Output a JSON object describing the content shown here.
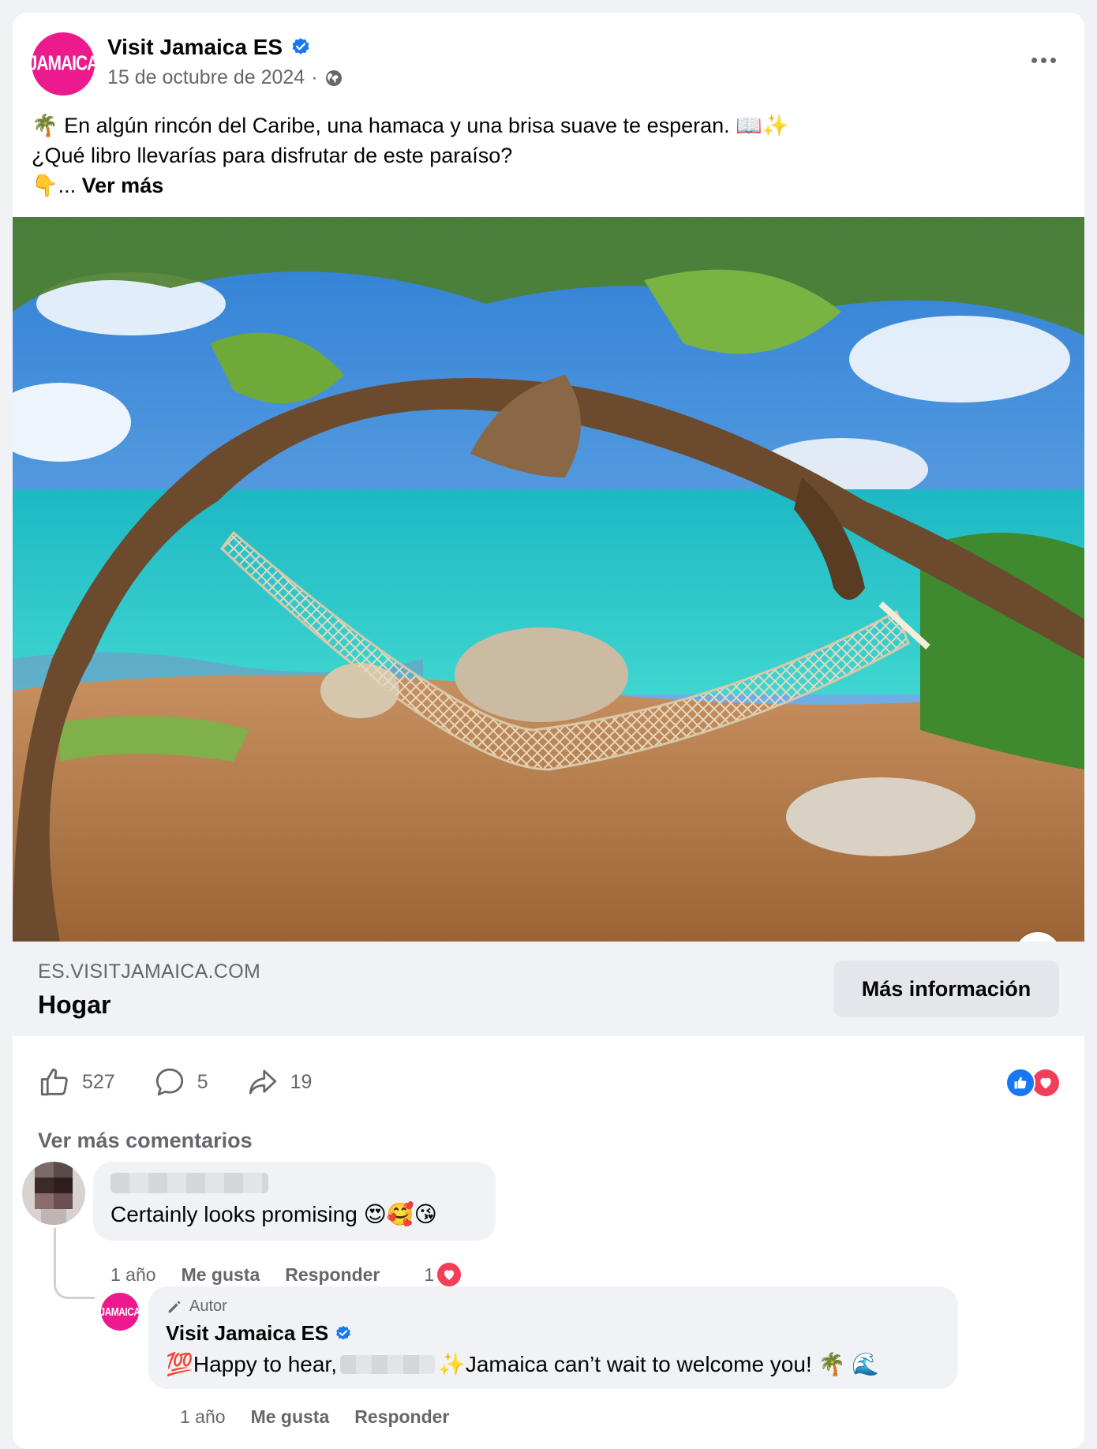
{
  "post": {
    "page_name": "Visit Jamaica ES",
    "avatar_text": "JAMAICA",
    "date": "15 de octubre de 2024",
    "separator": "·",
    "text_line1": "🌴 En algún rincón del Caribe, una hamaca y una brisa suave te esperan. 📖✨",
    "text_line2": "¿Qué libro llevarías para disfrutar de este paraíso?",
    "text_line3_prefix": "👇...",
    "see_more": "Ver más"
  },
  "link": {
    "domain": "ES.VISITJAMAICA.COM",
    "title": "Hogar",
    "cta": "Más información",
    "info_icon": "i"
  },
  "stats": {
    "likes": "527",
    "comments": "5",
    "shares": "19"
  },
  "comments_section": {
    "view_more": "Ver más comentarios",
    "comment": {
      "text": "Certainly looks promising 😍🥰😘",
      "time": "1 año",
      "like": "Me gusta",
      "reply": "Responder",
      "reaction_count": "1"
    },
    "reply": {
      "badge": "Autor",
      "name": "Visit Jamaica ES",
      "text_prefix": "💯Happy to hear,",
      "text_suffix": "✨Jamaica can’t wait to welcome you! 🌴 🌊",
      "time": "1 año",
      "like": "Me gusta",
      "reply": "Responder"
    }
  },
  "colors": {
    "brand_pink": "#ec1a8c",
    "facebook_blue": "#1877f2",
    "love_red": "#f33e58",
    "muted_text": "#65676b"
  }
}
